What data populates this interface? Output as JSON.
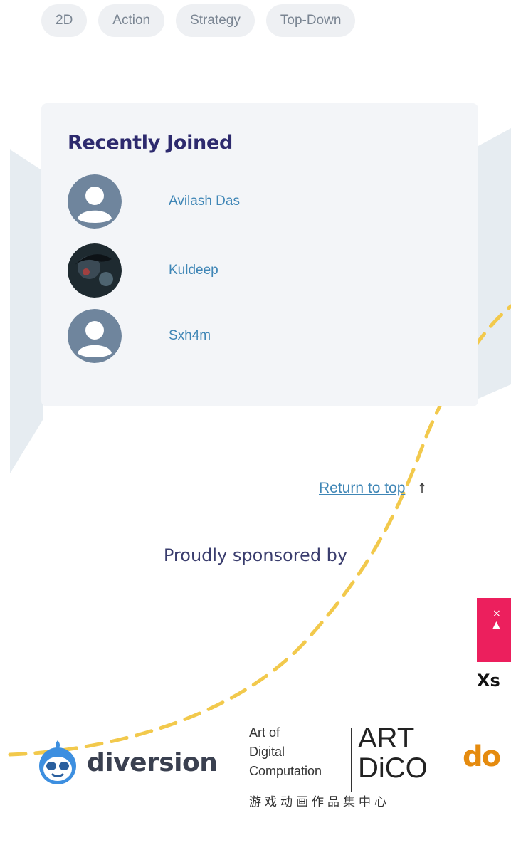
{
  "tags": [
    "2D",
    "Action",
    "Strategy",
    "Top-Down"
  ],
  "recently_joined": {
    "title": "Recently Joined",
    "members": [
      {
        "name": "Avilash Das",
        "avatar": "default-user-icon"
      },
      {
        "name": "Kuldeep",
        "avatar": "user-photo"
      },
      {
        "name": "Sxh4m",
        "avatar": "default-user-icon"
      }
    ]
  },
  "footer": {
    "return_to_top": "Return to top",
    "return_arrow": "↑",
    "sponsored_by": "Proudly sponsored by"
  },
  "sponsors": {
    "xsolla_partial": "Xs",
    "diversion": "diversion",
    "artdico": {
      "lines": [
        "Art of",
        "Digital",
        "Computation"
      ],
      "big": [
        "ART",
        "DiCO"
      ],
      "chinese": "游戏动画作品集中心"
    },
    "dot_partial": "do"
  },
  "colors": {
    "accent_link": "#3f86b6",
    "title": "#2d2a6e",
    "card_bg": "#f3f5f8",
    "dashed_line": "#f2c94c",
    "xsolla_pink": "#ec1f5d"
  }
}
